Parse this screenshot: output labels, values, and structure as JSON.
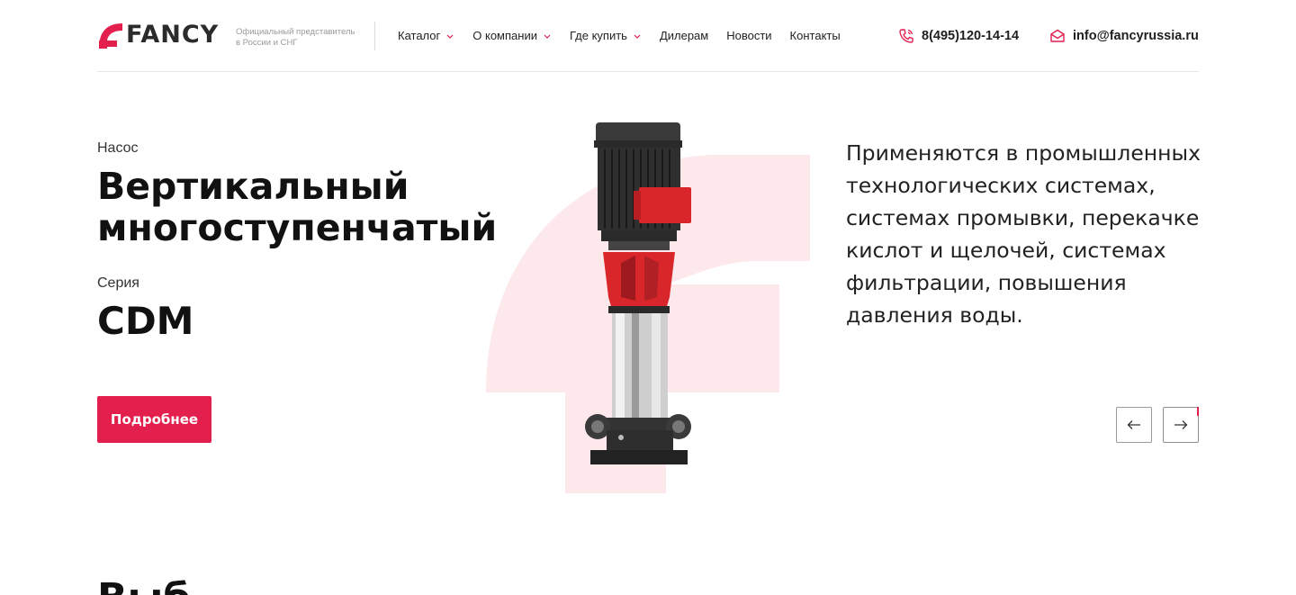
{
  "header": {
    "logo_text": "FANCY",
    "tagline_line1": "Официальный представитель",
    "tagline_line2": "в России и СНГ",
    "nav": [
      {
        "label": "Каталог",
        "has_dropdown": true
      },
      {
        "label": "О компании",
        "has_dropdown": true
      },
      {
        "label": "Где купить",
        "has_dropdown": true
      },
      {
        "label": "Дилерам",
        "has_dropdown": false
      },
      {
        "label": "Новости",
        "has_dropdown": false
      },
      {
        "label": "Контакты",
        "has_dropdown": false
      }
    ],
    "phone": "8(495)120-14-14",
    "email": "info@fancyrussia.ru"
  },
  "hero": {
    "product_label": "Насос",
    "title_line1": "Вертикальный",
    "title_line2": "многоступенчатый",
    "series_label": "Серия",
    "series_name": "CDM",
    "more_button": "Подробнее",
    "description": "Применяются в промышленных технологических системах, системах промывки, перекачке кислот и щелочей, системах фильтрации, повышения давления воды.",
    "prev_icon": "arrow-left-icon",
    "next_icon": "arrow-right-icon"
  },
  "next_section": {
    "title_fragment": "Выб"
  },
  "colors": {
    "accent": "#e31f4e",
    "bg_logo_tint": "#fde8ec",
    "text": "#111111",
    "divider": "#e8e8e8"
  }
}
